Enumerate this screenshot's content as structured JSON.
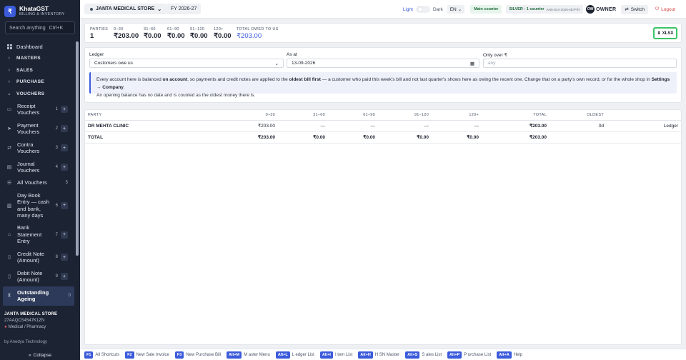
{
  "brand": {
    "logo": "₹",
    "name": "KhataGST",
    "tagline": "BILLING & INVENTORY"
  },
  "search": {
    "placeholder": "Search anything",
    "shortcut": "Ctrl+K"
  },
  "sidebar": {
    "dashboard": "Dashboard",
    "sections": {
      "masters": "MASTERS",
      "sales": "SALES",
      "purchase": "PURCHASE",
      "vouchers": "VOUCHERS"
    },
    "voucher_items": [
      {
        "label": "Receipt Vouchers",
        "count": "1"
      },
      {
        "label": "Payment Vouchers",
        "count": "2"
      },
      {
        "label": "Contra Vouchers",
        "count": "3"
      },
      {
        "label": "Journal Vouchers",
        "count": "4"
      },
      {
        "label": "All Vouchers",
        "count": "5"
      },
      {
        "label": "Day Book Entry — cash and bank, many days",
        "count": "6"
      },
      {
        "label": "Bank Statement Entry",
        "count": "7"
      },
      {
        "label": "Credit Note (Amount)",
        "count": "8"
      },
      {
        "label": "Debit Note (Amount)",
        "count": "9"
      },
      {
        "label": "Outstanding Ageing",
        "count": "0"
      }
    ],
    "plus": "+",
    "store": {
      "name": "JANTA MEDICAL STORE",
      "gstin": "27AAQCS4547K1ZN",
      "category": "Medical / Pharmacy"
    },
    "by_line": "by Anedya Technology",
    "collapse": "Collapse",
    "collapse_icon": "«"
  },
  "topbar": {
    "store_name": "JANTA MEDICAL STORE",
    "store_chevron": "⌄",
    "fy": "FY 2026-27",
    "light": "Light",
    "dark": "Dark",
    "lang": "EN",
    "main_counter": "Main counter",
    "silver": "SILVER - 1 counter",
    "license": "ANS-SLV-2026-4E7F97",
    "owner_initials": "OW",
    "owner": "OWNER",
    "switch": "Switch",
    "logout": "Logout"
  },
  "summary": {
    "parties_label": "PARTIES",
    "parties": "1",
    "b0_label": "0–30",
    "b0": "₹203.00",
    "b1_label": "31–60",
    "b1": "₹0.00",
    "b2_label": "61–90",
    "b2": "₹0.00",
    "b3_label": "91–120",
    "b3": "₹0.00",
    "b4_label": "120+",
    "b4": "₹0.00",
    "owed_label": "TOTAL OWED TO US",
    "owed": "₹203.00",
    "xlsx": "XLSX"
  },
  "filter": {
    "ledger_label": "Ledger",
    "ledger_value": "Customers owe us",
    "asat_label": "As at",
    "asat_value": "13-09-2026",
    "only_over_label": "Only over ₹",
    "only_over_placeholder": "any",
    "info_1": "Every account here is balanced ",
    "info_bold_1": "on account",
    "info_2": ", so payments and credit notes are applied to the ",
    "info_bold_2": "oldest bill first",
    "info_3": " — a customer who paid this week's bill and not last quarter's shows here as owing the recent one. Change that on a party's own record, or for the whole shop in ",
    "info_bold_3": "Settings → Company",
    "info_4": ".",
    "info_5": "An opening balance has no date and is counted as the oldest money there is."
  },
  "table": {
    "headers": {
      "party": "PARTY",
      "b0": "0–30",
      "b1": "31–60",
      "b2": "61–90",
      "b3": "91–120",
      "b4": "120+",
      "total": "TOTAL",
      "oldest": "OLDEST"
    },
    "row": {
      "party": "DR MEHTA CLINIC",
      "b0": "₹203.00",
      "b1": "—",
      "b2": "—",
      "b3": "—",
      "b4": "—",
      "total": "₹203.00",
      "oldest": "0d",
      "action": "Ledger"
    },
    "total": {
      "label": "TOTAL",
      "b0": "₹203.00",
      "b1": "₹0.00",
      "b2": "₹0.00",
      "b3": "₹0.00",
      "b4": "₹0.00",
      "total": "₹203.00"
    }
  },
  "shortcuts": [
    {
      "key": "F1",
      "label": "All Shortcuts"
    },
    {
      "key": "F2",
      "label": "New Sale Invoice"
    },
    {
      "key": "F3",
      "label": "New Purchase Bill"
    },
    {
      "key": "Alt+M",
      "label": "M aster Menu"
    },
    {
      "key": "Alt+L",
      "label": "L edger List"
    },
    {
      "key": "Alt+I",
      "label": "I tem List"
    },
    {
      "key": "Alt+H",
      "label": "H SN Master"
    },
    {
      "key": "Alt+S",
      "label": "S ales List"
    },
    {
      "key": "Alt+P",
      "label": "P urchase List"
    },
    {
      "key": "Alt+A",
      "label": "Help"
    }
  ],
  "colors": {
    "sidebar": "#1c2333",
    "accent": "#3b5bdb",
    "xlsx_border": "#3cc468",
    "logout": "#d33b3b"
  }
}
